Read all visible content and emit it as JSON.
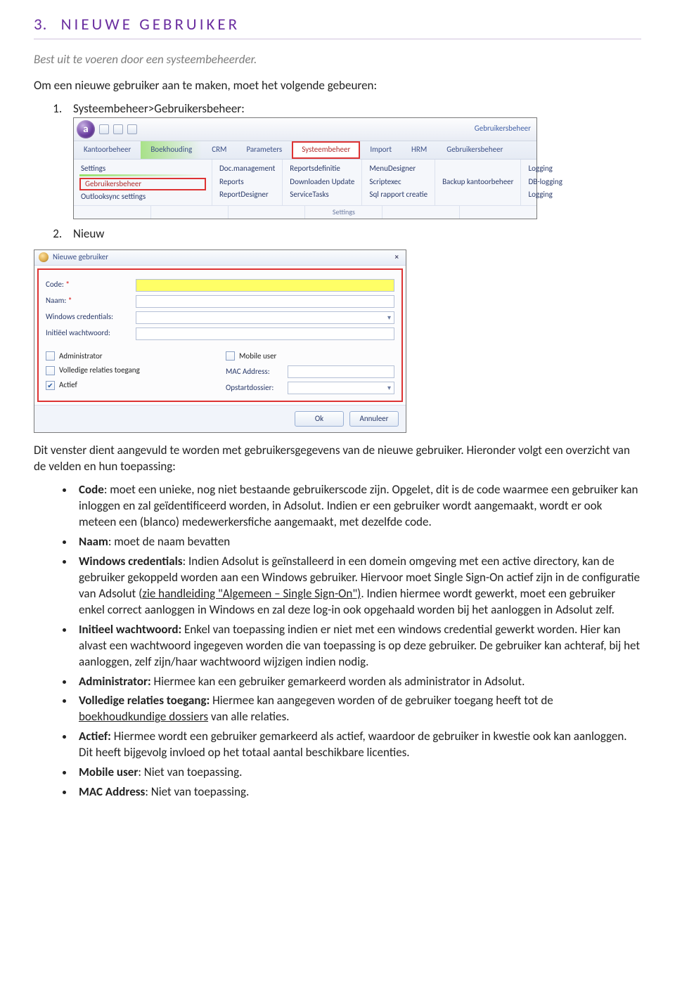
{
  "heading": {
    "num": "3.",
    "text": "NIEUWE GEBRUIKER"
  },
  "intro_italic": "Best uit te voeren door een systeembeheerder.",
  "intro_plain": "Om een nieuwe gebruiker aan te maken, moet het volgende gebeuren:",
  "step1": "Systeembeheer>Gebruikersbeheer:",
  "step2": "Nieuw",
  "ribbon": {
    "title": "Gebruikersbeheer",
    "tabs": [
      "Kantoorbeheer",
      "Boekhouding",
      "CRM",
      "Parameters",
      "Systeembeheer",
      "Import",
      "HRM",
      "Gebruikersbeheer"
    ],
    "hl_tab": "Systeembeheer",
    "rows": {
      "r1": [
        "Settings",
        "Doc.management",
        "Reportsdefinitie",
        "MenuDesigner",
        "",
        "Logging"
      ],
      "r2": [
        "Gebruikersbeheer",
        "Reports",
        "Downloaden Update",
        "Scriptexec",
        "Backup kantoorbeheer",
        "DB-logging"
      ],
      "r3": [
        "Outlooksync settings",
        "ReportDesigner",
        "ServiceTasks",
        "Sql rapport creatie",
        "",
        "Logging"
      ]
    },
    "footer": [
      "",
      "",
      "",
      "Settings",
      "",
      ""
    ]
  },
  "dialog": {
    "title": "Nieuwe gebruiker",
    "labels": {
      "code": "Code:",
      "naam": "Naam:",
      "win": "Windows credentials:",
      "pw": "Initiëel wachtwoord:",
      "admin": "Administrator",
      "rel": "Volledige relaties toegang",
      "actief": "Actief",
      "mobile": "Mobile user",
      "mac": "MAC Address:",
      "opstart": "Opstartdossier:"
    },
    "buttons": {
      "ok": "Ok",
      "cancel": "Annuleer"
    }
  },
  "after_dialog": "Dit venster dient aangevuld te worden met gebruikersgegevens van de nieuwe gebruiker. Hieronder volgt een overzicht van de velden en hun toepassing:",
  "fields": {
    "code_b": "Code",
    "code_t": ": moet een unieke, nog niet bestaande gebruikerscode zijn. Opgelet, dit is de code waarmee een gebruiker kan inloggen en zal geïdentificeerd worden, in Adsolut. Indien er een gebruiker wordt aangemaakt, wordt er ook meteen een (blanco) medewerkersfiche aangemaakt, met dezelfde code.",
    "naam_b": "Naam",
    "naam_t": ": moet de naam bevatten",
    "win_b": "Windows credentials",
    "win_t1": ": Indien Adsolut is geïnstalleerd in een domein omgeving met een active directory, kan de gebruiker gekoppeld worden aan een Windows gebruiker. Hiervoor moet Single Sign-On actief zijn in de configuratie van Adsolut (",
    "win_link": "zie handleiding \"Algemeen – Single Sign-On\")",
    "win_t2": ". Indien hiermee wordt gewerkt, moet een gebruiker enkel correct aanloggen in Windows en zal deze log-in ook opgehaald worden bij het aanloggen in Adsolut zelf.",
    "pw_b": "Initieel wachtwoord:",
    "pw_t": "  Enkel van toepassing indien er niet met een windows credential gewerkt worden. Hier kan alvast een wachtwoord ingegeven worden die van toepassing is op deze gebruiker. De gebruiker kan achteraf, bij het aanloggen, zelf zijn/haar wachtwoord wijzigen indien nodig.",
    "admin_b": "Administrator:",
    "admin_t": " Hiermee kan een gebruiker gemarkeerd worden als administrator in Adsolut.",
    "rel_b": "Volledige relaties toegang:",
    "rel_t1": " Hiermee kan aangegeven worden of de gebruiker toegang heeft tot de ",
    "rel_link": "boekhoudkundige dossiers",
    "rel_t2": " van alle relaties.",
    "actief_b": "Actief:",
    "actief_t": " Hiermee wordt een gebruiker gemarkeerd als actief, waardoor de gebruiker in kwestie ook kan aanloggen. Dit heeft bijgevolg invloed op het totaal aantal beschikbare licenties.",
    "mobile_b": "Mobile user",
    "mobile_t": ": Niet van toepassing.",
    "mac_b": "MAC Address",
    "mac_t": ": Niet van toepassing."
  }
}
